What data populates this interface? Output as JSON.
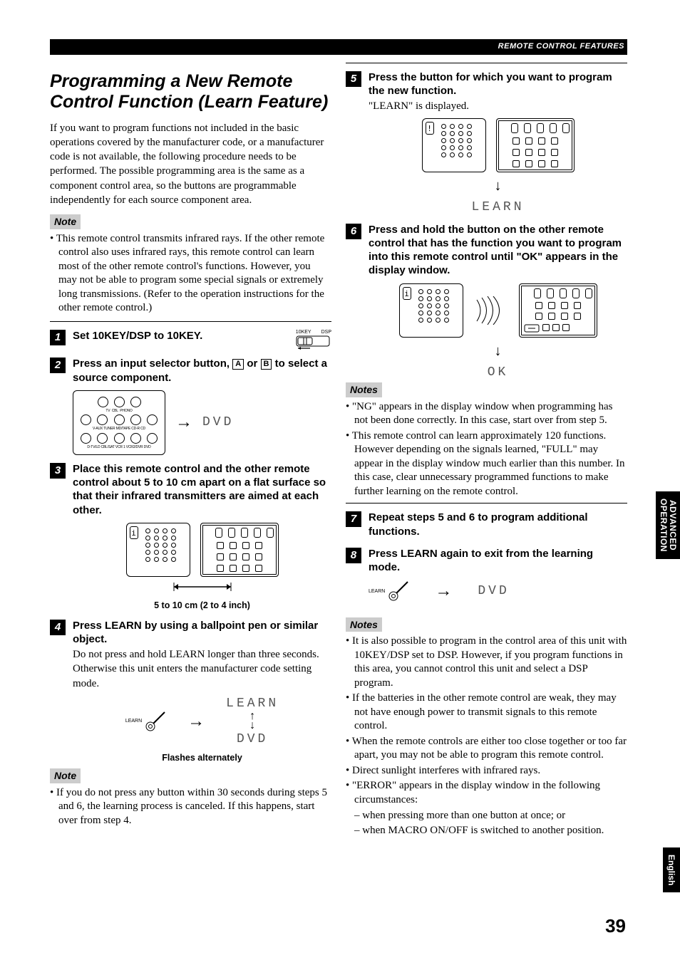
{
  "header": {
    "right": "REMOTE CONTROL FEATURES"
  },
  "section_title": "Programming a New Remote Control Function (Learn Feature)",
  "intro": "If you want to program functions not included in the basic operations covered by the manufacturer code, or a manufacturer code is not available, the following procedure needs to be performed. The possible programming area is the same as a component control area, so the buttons are programmable independently for each source component area.",
  "note_labels": {
    "note": "Note",
    "notes": "Notes"
  },
  "left": {
    "note1": "This remote control transmits infrared rays. If the other remote control also uses infrared rays, this remote control can learn most of the other remote control's functions. However, you may not be able to program some special signals or extremely long transmissions. (Refer to the operation instructions for the other remote control.)",
    "step1": {
      "num": "1",
      "heading": "Set 10KEY/DSP to 10KEY.",
      "switch_labels": {
        "l": "10KEY",
        "r": "DSP"
      }
    },
    "step2": {
      "num": "2",
      "heading_pre": "Press an input selector button, ",
      "keyA": "A",
      "or": " or ",
      "keyB": "B",
      "heading_post": " to select a source component.",
      "grid_labels": [
        "TV",
        "CBL",
        "PHONO",
        "V-AUX",
        "TUNER",
        "MD/TAPE",
        "CD-R",
        "CD",
        "D-TV/LD",
        "CBL/SAT",
        "VCR 1",
        "VCR2/DVR",
        "DVD"
      ],
      "lcd": "DVD"
    },
    "step3": {
      "num": "3",
      "heading": "Place this remote control and the other remote control about 5 to 10 cm apart on a flat surface so that their infrared transmitters are aimed at each other.",
      "caption": "5 to 10 cm (2 to 4 inch)"
    },
    "step4": {
      "num": "4",
      "heading": "Press LEARN by using a ballpoint pen or similar object.",
      "body": "Do not press and hold LEARN longer than three seconds. Otherwise this unit enters the manufacturer code setting mode.",
      "learn_label": "LEARN",
      "lcd_learn": "LEARN",
      "lcd_dvd": "DVD",
      "caption": "Flashes alternately"
    },
    "note2": "If you do not press any button within 30 seconds during steps 5 and 6, the learning process is canceled. If this happens, start over from step 4."
  },
  "right": {
    "step5": {
      "num": "5",
      "heading": "Press the button for which you want to program the new function.",
      "body": "\"LEARN\" is displayed.",
      "lcd": "LEARN"
    },
    "step6": {
      "num": "6",
      "heading": "Press and hold the button on the other remote control that has the function you want to program into this remote control until \"OK\" appears in the display window.",
      "lcd": "OK"
    },
    "notes1": [
      "\"NG\" appears in the display window when programming has not been done correctly. In this case, start over from step 5.",
      "This remote control can learn approximately 120 functions. However depending on the signals learned, \"FULL\" may appear in the display window much earlier than this number. In this case, clear unnecessary programmed functions to make further learning on the remote control."
    ],
    "step7": {
      "num": "7",
      "heading": "Repeat steps 5 and 6 to program additional functions."
    },
    "step8": {
      "num": "8",
      "heading": "Press LEARN again to exit from the learning mode.",
      "learn_label": "LEARN",
      "lcd": "DVD"
    },
    "notes2": {
      "items": [
        "It is also possible to program in the control area of this unit with 10KEY/DSP set to DSP. However, if you program functions in this area, you cannot control this unit and select a DSP program.",
        "If the batteries in the other remote control are weak, they may not have enough power to transmit signals to this remote control.",
        "When the remote controls are either too close together or too far apart, you may not be able to program this remote control.",
        "Direct sunlight interferes with infrared rays.",
        "\"ERROR\" appears in the display window in the following circumstances:"
      ],
      "subs": [
        "– when pressing more than one button at once; or",
        "– when MACRO ON/OFF is switched to another position."
      ]
    }
  },
  "tabs": {
    "advanced": "ADVANCED\nOPERATION",
    "english": "English"
  },
  "page": "39"
}
